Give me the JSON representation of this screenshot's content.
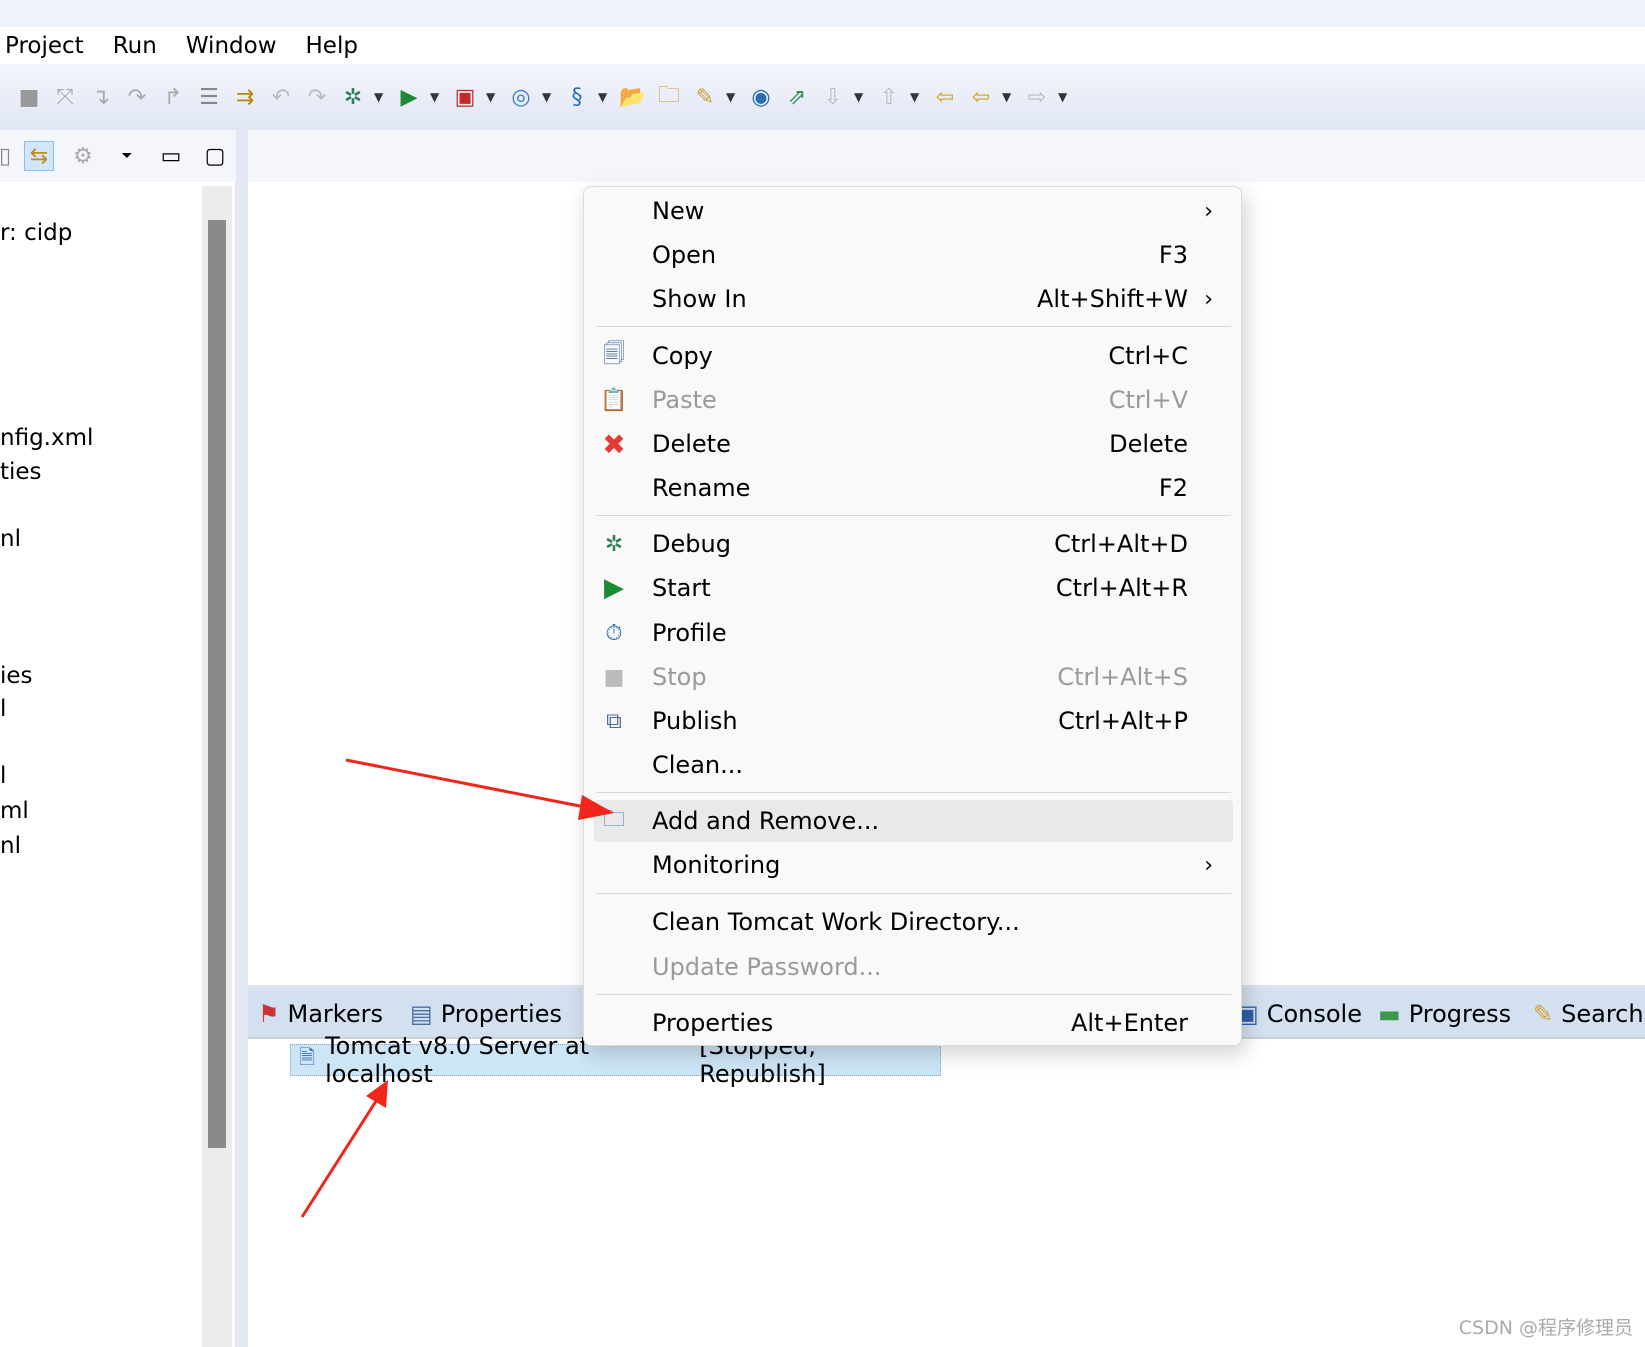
{
  "menubar": {
    "items": [
      "Project",
      "Run",
      "Window",
      "Help"
    ]
  },
  "toolbar": {
    "icons": [
      "stop-icon",
      "disconnect-icon",
      "step-into-icon",
      "step-over-icon",
      "step-return-icon",
      "drop-to-frame-icon",
      "use-step-filters-icon",
      "undo-icon",
      "redo-icon",
      "debug-icon",
      "run-icon",
      "run-external-icon",
      "new-wizard-icon",
      "new-server-icon",
      "open-type-icon",
      "open-task-icon",
      "search-icon",
      "browser-icon",
      "publish-icon",
      "next-annotation-icon",
      "previous-annotation-icon",
      "last-edit-icon",
      "back-icon",
      "forward-icon"
    ]
  },
  "tree": {
    "items": [
      "r: cidp",
      "nfig.xml",
      "ties",
      "nl",
      "ies",
      "l",
      "l",
      "ml",
      "nl"
    ]
  },
  "context_menu": {
    "items": [
      {
        "label": "New",
        "shortcut": "",
        "submenu": ">",
        "icon": ""
      },
      {
        "label": "Open",
        "shortcut": "F3",
        "icon": ""
      },
      {
        "label": "Show In",
        "shortcut": "Alt+Shift+W",
        "submenu": ">",
        "icon": ""
      },
      {
        "label": "Copy",
        "shortcut": "Ctrl+C",
        "icon": "copy-icon"
      },
      {
        "label": "Paste",
        "shortcut": "Ctrl+V",
        "icon": "paste-icon",
        "disabled": true
      },
      {
        "label": "Delete",
        "shortcut": "Delete",
        "icon": "delete-icon"
      },
      {
        "label": "Rename",
        "shortcut": "F2",
        "icon": ""
      },
      {
        "label": "Debug",
        "shortcut": "Ctrl+Alt+D",
        "icon": "debug-icon"
      },
      {
        "label": "Start",
        "shortcut": "Ctrl+Alt+R",
        "icon": "start-icon"
      },
      {
        "label": "Profile",
        "shortcut": "",
        "icon": "profile-icon"
      },
      {
        "label": "Stop",
        "shortcut": "Ctrl+Alt+S",
        "icon": "stop-icon",
        "disabled": true
      },
      {
        "label": "Publish",
        "shortcut": "Ctrl+Alt+P",
        "icon": "publish-icon"
      },
      {
        "label": "Clean...",
        "shortcut": "",
        "icon": ""
      },
      {
        "label": "Add and Remove...",
        "shortcut": "",
        "icon": "add-remove-icon",
        "highlighted": true
      },
      {
        "label": "Monitoring",
        "shortcut": "",
        "submenu": ">",
        "icon": ""
      },
      {
        "label": "Clean Tomcat Work Directory...",
        "shortcut": "",
        "icon": ""
      },
      {
        "label": "Update Password...",
        "shortcut": "",
        "icon": "",
        "disabled": true
      },
      {
        "label": "Properties",
        "shortcut": "Alt+Enter",
        "icon": ""
      }
    ]
  },
  "bottom_tabs": [
    "Markers",
    "Properties",
    "Console",
    "Progress",
    "Search"
  ],
  "server": {
    "name": "Tomcat v8.0 Server at localhost",
    "status": "[Stopped, Republish]"
  },
  "annotation_color": "#f0261b",
  "watermark": "CSDN @程序修理员"
}
